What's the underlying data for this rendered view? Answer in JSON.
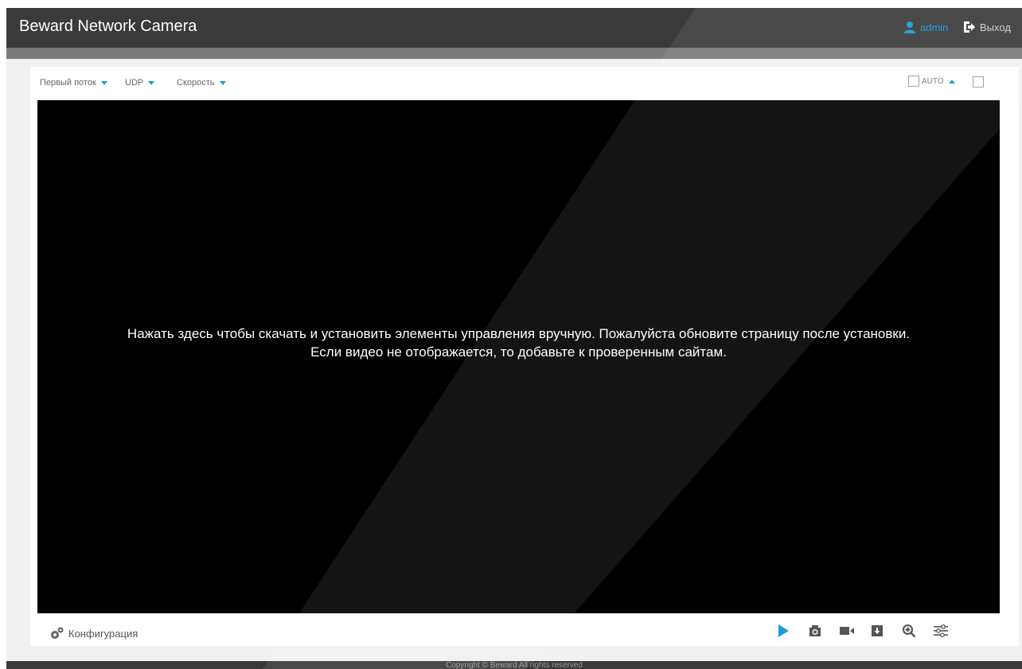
{
  "header": {
    "title": "Beward Network Camera",
    "user": "admin",
    "logout": "Выход"
  },
  "toolbar": {
    "stream": "Первый поток",
    "protocol": "UDP",
    "speed": "Скорость",
    "scale": "AUTO"
  },
  "video": {
    "line1": "Нажать здесь чтобы скачать и установить элементы управления вручную. Пожалуйста обновите страницу после установки.",
    "line2": "Если видео не отображается, то добавьте к проверенным сайтам."
  },
  "controls": {
    "config": "Конфигурация"
  },
  "footer": {
    "copyright": "Copyright © Beward All rights reserved"
  },
  "colors": {
    "accent": "#1a9bdc",
    "header_bg": "#3a3a3a"
  },
  "icons": [
    "user-icon",
    "logout-icon",
    "scale-icon",
    "fullscreen-icon",
    "gears-icon",
    "play-icon",
    "snapshot-icon",
    "record-icon",
    "download-icon",
    "zoom-icon",
    "settings-sliders-icon"
  ]
}
